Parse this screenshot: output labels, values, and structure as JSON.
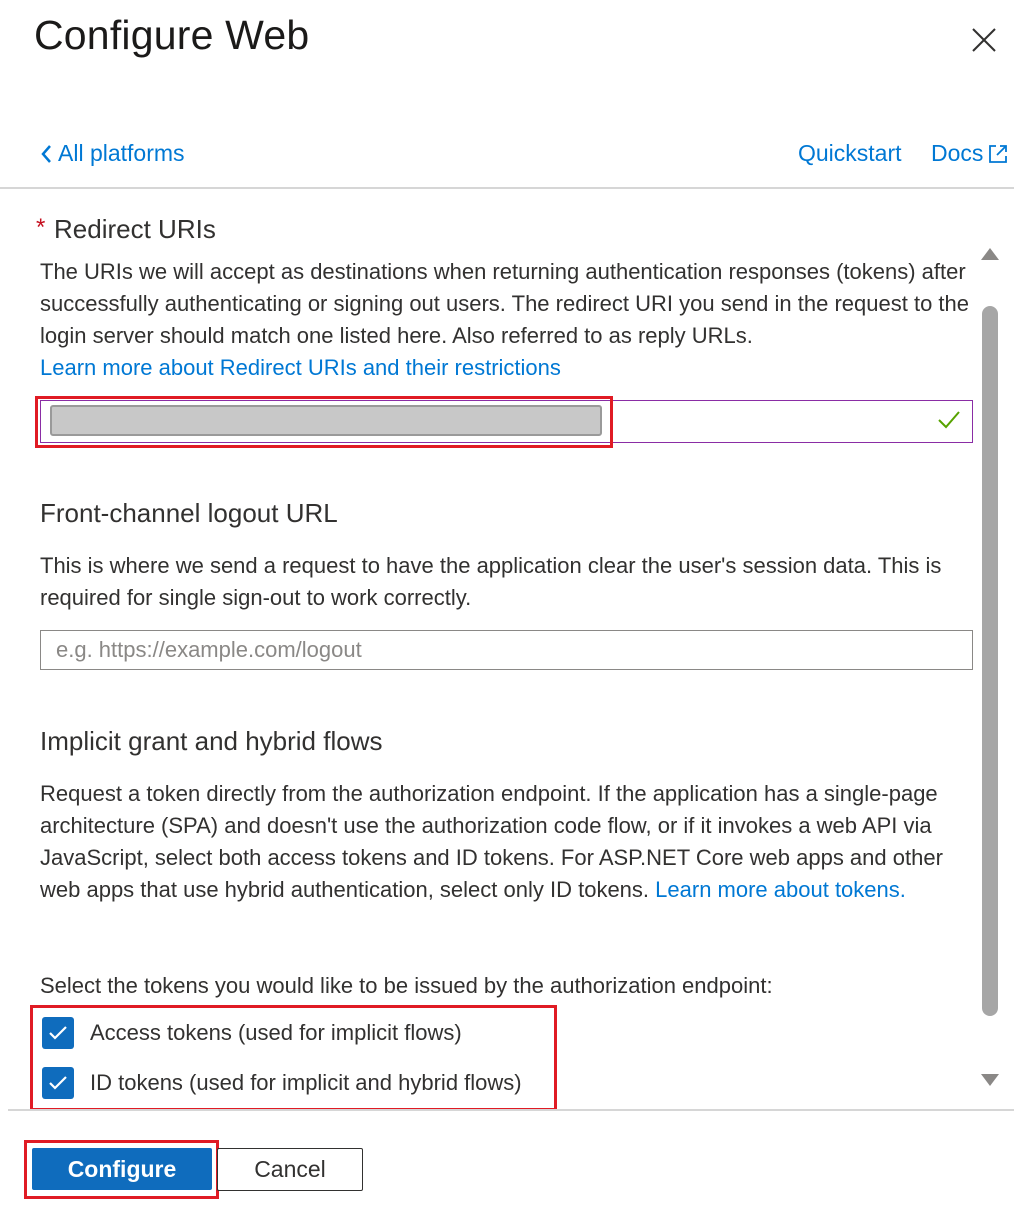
{
  "header": {
    "title": "Configure Web",
    "close_icon": "close-icon"
  },
  "nav": {
    "back_label": "All platforms",
    "quickstart_label": "Quickstart",
    "docs_label": "Docs"
  },
  "redirect": {
    "required_marker": "*",
    "title": "Redirect URIs",
    "description": "The URIs we will accept as destinations when returning authentication responses (tokens) after successfully authenticating or signing out users. The redirect URI you send in the request to the login server should match one listed here. Also referred to as reply URLs.",
    "learn_more": "Learn more about Redirect URIs and their restrictions",
    "value_redacted": true
  },
  "logout": {
    "title": "Front-channel logout URL",
    "description": "This is where we send a request to have the application clear the user's session data. This is required for single sign-out to work correctly.",
    "placeholder": "e.g. https://example.com/logout",
    "value": ""
  },
  "implicit": {
    "title": "Implicit grant and hybrid flows",
    "description": "Request a token directly from the authorization endpoint. If the application has a single-page architecture (SPA) and doesn't use the authorization code flow, or if it invokes a web API via JavaScript, select both access tokens and ID tokens. For ASP.NET Core web apps and other web apps that use hybrid authentication, select only ID tokens.",
    "learn_more": "Learn more about tokens.",
    "select_prompt": "Select the tokens you would like to be issued by the authorization endpoint:",
    "options": [
      {
        "label": "Access tokens (used for implicit flows)",
        "checked": true
      },
      {
        "label": "ID tokens (used for implicit and hybrid flows)",
        "checked": true
      }
    ]
  },
  "footer": {
    "configure_label": "Configure",
    "cancel_label": "Cancel"
  },
  "colors": {
    "accent": "#0078d4",
    "primary_button": "#0f6cbd",
    "highlight": "#e01b24",
    "valid_check": "#57a300"
  }
}
